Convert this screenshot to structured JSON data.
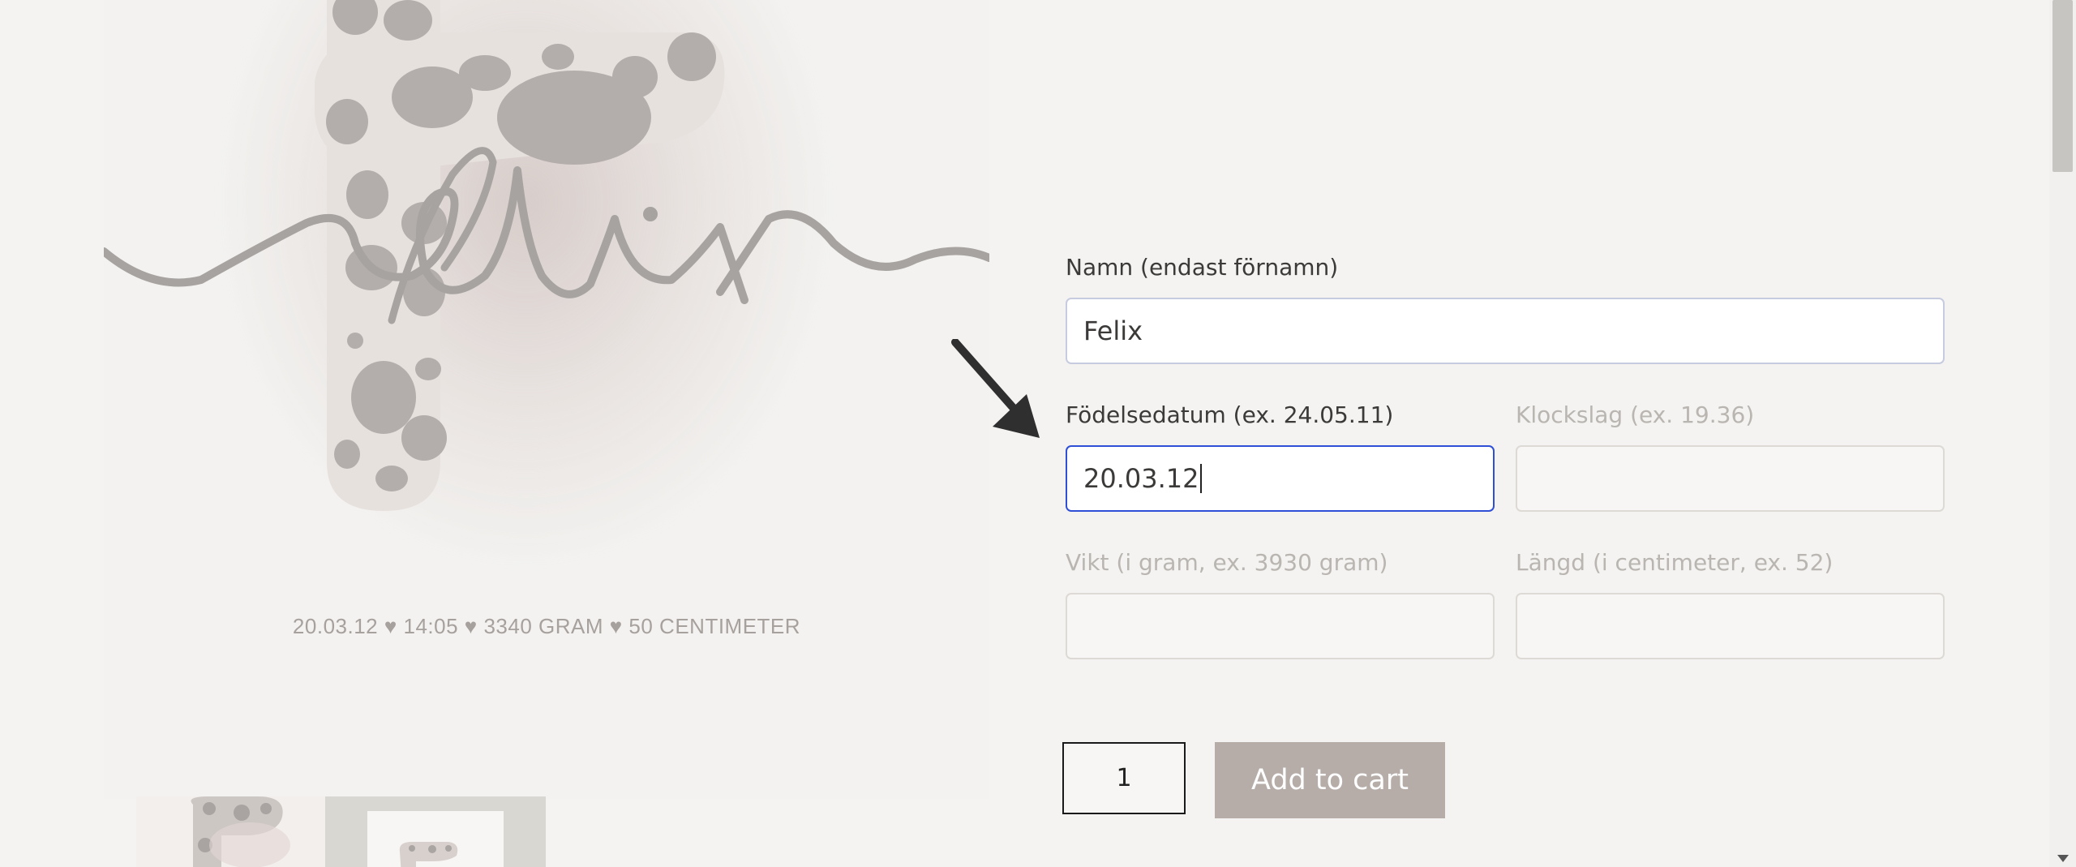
{
  "product": {
    "preview_name": "felix",
    "meta_line": "20.03.12 ♥ 14:05 ♥ 3340 GRAM ♥ 50 CENTIMETER"
  },
  "form": {
    "name_label": "Namn (endast förnamn)",
    "name_value": "Felix",
    "birthdate_label": "Födelsedatum (ex. 24.05.11)",
    "birthdate_value": "20.03.12",
    "time_label": "Klockslag (ex. 19.36)",
    "time_value": "",
    "weight_label": "Vikt (i gram, ex. 3930 gram)",
    "weight_value": "",
    "length_label": "Längd (i centimeter, ex. 52)",
    "length_value": ""
  },
  "cart": {
    "quantity": "1",
    "add_to_cart_label": "Add to cart"
  },
  "colors": {
    "accent_focus": "#2e4fd6",
    "cart_button": "#b6ada9",
    "background": "#f4f3f1"
  },
  "icons": {
    "annotation_arrow": "arrow-down-right-icon",
    "scroll_down": "chevron-down-icon"
  }
}
